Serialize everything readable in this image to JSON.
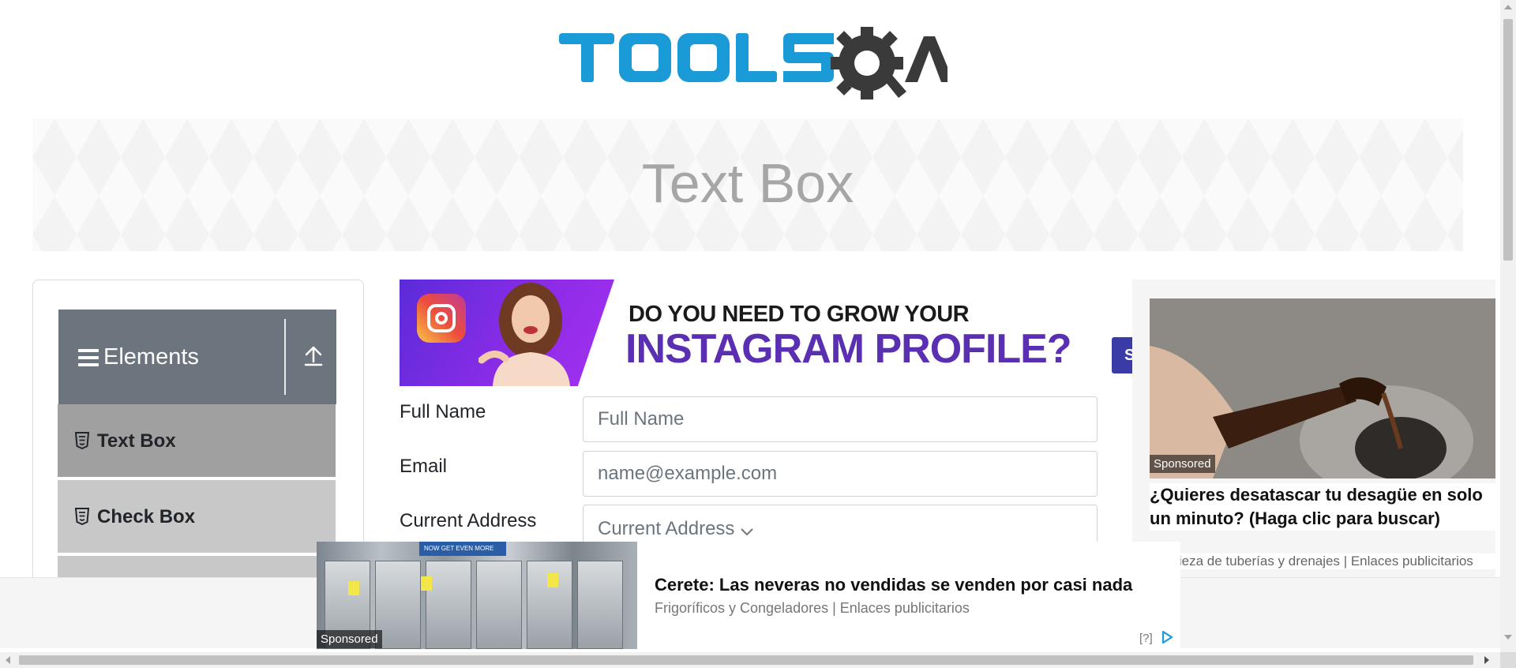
{
  "header": {
    "logo_text": "TOOLSQA"
  },
  "banner": {
    "title": "Text Box"
  },
  "sidebar": {
    "group_title": "Elements",
    "items": [
      {
        "label": "Text Box",
        "active": true
      },
      {
        "label": "Check Box",
        "active": false
      }
    ]
  },
  "instagram_ad": {
    "line1": "DO YOU NEED TO GROW YOUR",
    "line2": "INSTAGRAM PROFILE?",
    "button_letter": "S"
  },
  "form": {
    "fullname_label": "Full Name",
    "fullname_placeholder": "Full Name",
    "email_label": "Email",
    "email_placeholder": "name@example.com",
    "address_label": "Current Address",
    "address_placeholder": "Current Address"
  },
  "right_ad": {
    "sponsored": "Sponsored",
    "headline": "¿Quieres desatascar tu desagüe en solo un minuto? (Haga clic para buscar)",
    "source": "Limpieza de tuberías y drenajes | Enlaces publicitarios"
  },
  "bottom_ad": {
    "sponsored": "Sponsored",
    "title": "Cerete: Las neveras no vendidas se venden por casi nada",
    "source": "Frigoríficos y Congeladores | Enlaces publicitarios",
    "help": "[?]",
    "store_banner": "NOW GET EVEN MORE"
  },
  "colors": {
    "logo_blue": "#1a9ad6",
    "logo_gray": "#3a3a3a",
    "sidebar_header": "#6c757d",
    "menu_active": "#a0a0a0",
    "menu_item": "#c8c8c8",
    "insta_purple": "#5a2fb2"
  }
}
